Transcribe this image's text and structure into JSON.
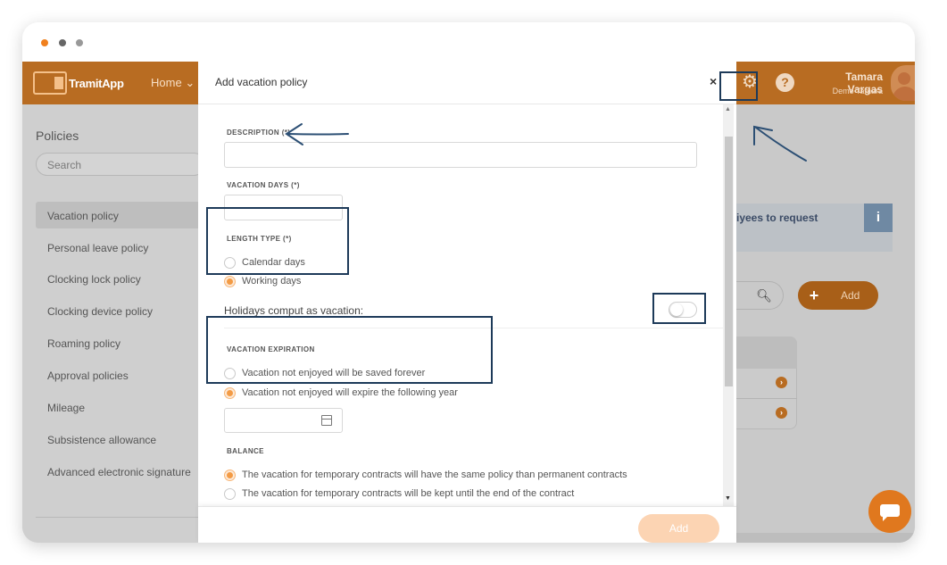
{
  "window": {
    "dots": [
      "#f0801e",
      "#666666",
      "#999999"
    ]
  },
  "topbar": {
    "logo_text": "TramitApp",
    "home_label": "Home",
    "user_name": "Tamara Vargas",
    "user_company": "Demo Tamara",
    "brand_color": "#b86c22"
  },
  "sidebar": {
    "title": "Policies",
    "search_placeholder": "Search",
    "items": [
      {
        "label": "Vacation policy",
        "active": true
      },
      {
        "label": "Personal leave policy"
      },
      {
        "label": "Clocking lock policy"
      },
      {
        "label": "Clocking device policy"
      },
      {
        "label": "Roaming policy"
      },
      {
        "label": "Approval policies"
      },
      {
        "label": "Mileage"
      },
      {
        "label": "Subsistence allowance"
      },
      {
        "label": "Advanced electronic signature"
      }
    ]
  },
  "background": {
    "alert_text": "iyees to request",
    "info_icon": "i",
    "add_label": "Add"
  },
  "modal": {
    "title": "Add vacation policy",
    "close": "×",
    "description_label": "DESCRIPTION (*)",
    "description_value": "",
    "vacation_days_label": "VACATION DAYS (*)",
    "vacation_days_value": "",
    "length_type_label": "LENGTH TYPE (*)",
    "length_type_options": [
      {
        "label": "Calendar days",
        "checked": false
      },
      {
        "label": "Working days",
        "checked": true
      }
    ],
    "holidays_label": "Holidays comput as vacation:",
    "holidays_toggle": false,
    "expiration_label": "VACATION EXPIRATION",
    "expiration_options": [
      {
        "label": "Vacation not enjoyed will be saved forever",
        "checked": false
      },
      {
        "label": "Vacation not enjoyed will expire the following year",
        "checked": true
      }
    ],
    "expiration_date_value": "",
    "balance_label": "BALANCE",
    "balance_options": [
      {
        "label": "The vacation for temporary contracts will have the same policy than permanent contracts",
        "checked": true
      },
      {
        "label": "The vacation for temporary contracts will be kept until the end of the contract",
        "checked": false
      }
    ],
    "footer_add": "Add"
  }
}
